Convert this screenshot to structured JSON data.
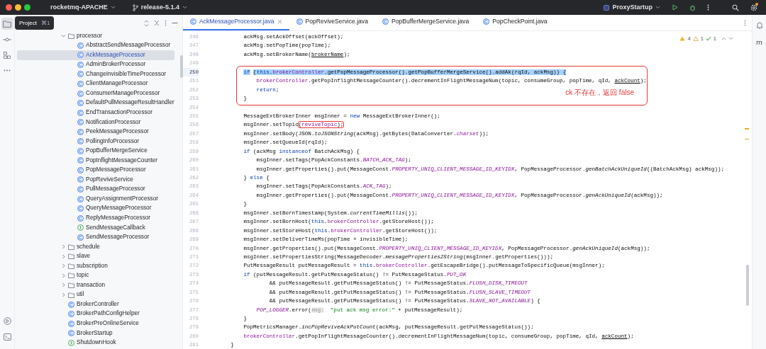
{
  "title_bar": {
    "project": "rocketmq-APACHE",
    "branch": "release-5.1.4",
    "run_config": "ProxyStartup"
  },
  "tooltip": {
    "label": "Project",
    "shortcut": "⌘1"
  },
  "tool_strip_top": [
    {
      "kind": "folder",
      "selected": true
    },
    {
      "kind": "commit",
      "selected": false
    },
    {
      "kind": "structure",
      "selected": false
    },
    {
      "kind": "more",
      "selected": false
    }
  ],
  "tool_strip_bottom": [
    {
      "kind": "run",
      "selected": false
    },
    {
      "kind": "terminal",
      "selected": false
    }
  ],
  "project_tree": [
    {
      "label": "processor",
      "kind": "folder",
      "expanded": true,
      "selected": false,
      "children": [
        {
          "label": "AbstractSendMessageProcessor",
          "kind": "class",
          "selected": false
        },
        {
          "label": "AckMessageProcessor",
          "kind": "class",
          "selected": true
        },
        {
          "label": "AdminBrokerProcessor",
          "kind": "class",
          "selected": false
        },
        {
          "label": "ChangeInvisibleTimeProcessor",
          "kind": "class",
          "selected": false
        },
        {
          "label": "ClientManageProcessor",
          "kind": "class",
          "selected": false
        },
        {
          "label": "ConsumerManageProcessor",
          "kind": "class",
          "selected": false
        },
        {
          "label": "DefaultPullMessageResultHandler",
          "kind": "class",
          "selected": false
        },
        {
          "label": "EndTransactionProcessor",
          "kind": "class",
          "selected": false
        },
        {
          "label": "NotificationProcessor",
          "kind": "class",
          "selected": false
        },
        {
          "label": "PeekMessageProcessor",
          "kind": "class",
          "selected": false
        },
        {
          "label": "PollingInfoProcessor",
          "kind": "class",
          "selected": false
        },
        {
          "label": "PopBufferMergeService",
          "kind": "class",
          "selected": false
        },
        {
          "label": "PopInflightMessageCounter",
          "kind": "class",
          "selected": false
        },
        {
          "label": "PopMessageProcessor",
          "kind": "class",
          "selected": false
        },
        {
          "label": "PopReviveService",
          "kind": "class",
          "selected": false
        },
        {
          "label": "PullMessageProcessor",
          "kind": "class",
          "selected": false
        },
        {
          "label": "QueryAssignmentProcessor",
          "kind": "class",
          "selected": false
        },
        {
          "label": "QueryMessageProcessor",
          "kind": "class",
          "selected": false
        },
        {
          "label": "ReplyMessageProcessor",
          "kind": "class",
          "selected": false
        },
        {
          "label": "SendMessageCallback",
          "kind": "interface",
          "selected": false
        },
        {
          "label": "SendMessageProcessor",
          "kind": "class",
          "selected": false
        }
      ]
    },
    {
      "label": "schedule",
      "kind": "folder",
      "expanded": false,
      "selected": false
    },
    {
      "label": "slave",
      "kind": "folder",
      "expanded": false,
      "selected": false
    },
    {
      "label": "subscription",
      "kind": "folder",
      "expanded": false,
      "selected": false
    },
    {
      "label": "topic",
      "kind": "folder",
      "expanded": false,
      "selected": false
    },
    {
      "label": "transaction",
      "kind": "folder",
      "expanded": false,
      "selected": false
    },
    {
      "label": "util",
      "kind": "folder",
      "expanded": false,
      "selected": false
    },
    {
      "label": "BrokerController",
      "kind": "class",
      "selected": false
    },
    {
      "label": "BrokerPathConfigHelper",
      "kind": "class",
      "selected": false
    },
    {
      "label": "BrokerPreOnlineService",
      "kind": "class",
      "selected": false
    },
    {
      "label": "BrokerStartup",
      "kind": "class",
      "selected": false
    },
    {
      "label": "ShutdownHook",
      "kind": "interface",
      "selected": false
    }
  ],
  "editor_tabs": [
    {
      "label": "AckMessageProcessor.java",
      "selected": true
    },
    {
      "label": "PopReviveService.java",
      "selected": false
    },
    {
      "label": "PopBufferMergeService.java",
      "selected": false
    },
    {
      "label": "PopCheckPoint.java",
      "selected": false
    }
  ],
  "inspections": {
    "warnings": "4",
    "weak_warnings": "1",
    "passed": "1"
  },
  "right_strip": {
    "plugin_glyph": "m"
  },
  "code_lines": [
    {
      "number": "246",
      "highlighted": false,
      "segments": [
        {
          "text": "        ackMsg.setAckOffset(ackOffset);",
          "kind": "plain"
        }
      ]
    },
    {
      "number": "247",
      "highlighted": false,
      "segments": [
        {
          "text": "        ackMsg.setPopTime(popTime);",
          "kind": "plain"
        }
      ]
    },
    {
      "number": "248",
      "highlighted": false,
      "segments": [
        {
          "text": "        ackMsg.setBrokerName(",
          "kind": "plain"
        },
        {
          "text": "brokerName",
          "kind": "underlined"
        },
        {
          "text": ");",
          "kind": "plain"
        }
      ]
    },
    {
      "number": "249",
      "highlighted": false
    },
    {
      "number": "250",
      "highlighted": true,
      "in_box": true,
      "segments": [
        {
          "text": "        if",
          "kind": "keyword"
        },
        {
          "text": " (",
          "kind": "plain"
        },
        {
          "text": "this",
          "kind": "keyword"
        },
        {
          "text": ".",
          "kind": "plain"
        },
        {
          "text": "brokerController",
          "kind": "field"
        },
        {
          "text": ".getPopMessageProcessor().getPopBufferMergeService().addAk(rqId, ackMsg)) {",
          "kind": "plain"
        }
      ]
    },
    {
      "number": "251",
      "highlighted": false,
      "in_box": true,
      "segments": [
        {
          "text": "            brokerController",
          "kind": "field"
        },
        {
          "text": ".getPopInflightMessageCounter().decrementInFlightMessageNum(topic, consumeGroup, popTime, qId, ",
          "kind": "plain"
        },
        {
          "text": "ackCount",
          "kind": "underlined"
        },
        {
          "text": ");",
          "kind": "plain"
        }
      ]
    },
    {
      "number": "252",
      "highlighted": false,
      "in_box": true,
      "note": "ck 不存在，返回 false",
      "segments": [
        {
          "text": "            return",
          "kind": "keyword"
        },
        {
          "text": ";",
          "kind": "plain"
        }
      ]
    },
    {
      "number": "253",
      "highlighted": false,
      "in_box": true,
      "segments": [
        {
          "text": "        }",
          "kind": "plain"
        }
      ]
    },
    {
      "number": "254",
      "highlighted": false
    },
    {
      "number": "255",
      "highlighted": false,
      "segments": [
        {
          "text": "        MessageExtBrokerInner msgInner = ",
          "kind": "plain"
        },
        {
          "text": "new",
          "kind": "keyword"
        },
        {
          "text": " MessageExtBrokerInner();",
          "kind": "plain"
        }
      ]
    },
    {
      "number": "256",
      "highlighted": false,
      "segments": [
        {
          "text": "        msgInner.setTopic",
          "kind": "plain"
        },
        {
          "text": "(",
          "kind": "plain",
          "circled": true
        },
        {
          "text": "reviveTopic",
          "kind": "field",
          "circled": true
        },
        {
          "text": ");",
          "kind": "plain",
          "circled": true
        }
      ]
    },
    {
      "number": "257",
      "highlighted": false,
      "segments": [
        {
          "text": "        msgInner.setBody(JSON.",
          "kind": "plain"
        },
        {
          "text": "toJSONString",
          "kind": "static"
        },
        {
          "text": "(ackMsg).getBytes(DataConverter.",
          "kind": "plain"
        },
        {
          "text": "charset",
          "kind": "constant"
        },
        {
          "text": "));",
          "kind": "plain"
        }
      ]
    },
    {
      "number": "258",
      "highlighted": false,
      "segments": [
        {
          "text": "        msgInner.setQueueId(rqId);",
          "kind": "plain"
        }
      ]
    },
    {
      "number": "259",
      "highlighted": false,
      "segments": [
        {
          "text": "        if",
          "kind": "keyword"
        },
        {
          "text": " (ackMsg ",
          "kind": "plain"
        },
        {
          "text": "instanceof",
          "kind": "keyword"
        },
        {
          "text": " BatchAckMsg) {",
          "kind": "plain"
        }
      ]
    },
    {
      "number": "260",
      "highlighted": false,
      "segments": [
        {
          "text": "            msgInner.setTags(PopAckConstants.",
          "kind": "plain"
        },
        {
          "text": "BATCH_ACK_TAG",
          "kind": "constant"
        },
        {
          "text": ");",
          "kind": "plain"
        }
      ]
    },
    {
      "number": "261",
      "highlighted": false,
      "segments": [
        {
          "text": "            msgInner.getProperties().put(MessageConst.",
          "kind": "plain"
        },
        {
          "text": "PROPERTY_UNIQ_CLIENT_MESSAGE_ID_KEYIDX",
          "kind": "constant"
        },
        {
          "text": ", PopMessageProcessor.",
          "kind": "plain"
        },
        {
          "text": "genBatchAckUniqueId",
          "kind": "static"
        },
        {
          "text": "((BatchAckMsg) ackMsg));",
          "kind": "plain"
        }
      ]
    },
    {
      "number": "262",
      "highlighted": false,
      "segments": [
        {
          "text": "        } ",
          "kind": "plain"
        },
        {
          "text": "else",
          "kind": "keyword"
        },
        {
          "text": " {",
          "kind": "plain"
        }
      ]
    },
    {
      "number": "263",
      "highlighted": false,
      "segments": [
        {
          "text": "            msgInner.setTags(PopAckConstants.",
          "kind": "plain"
        },
        {
          "text": "ACK_TAG",
          "kind": "constant"
        },
        {
          "text": ");",
          "kind": "plain"
        }
      ]
    },
    {
      "number": "264",
      "highlighted": false,
      "segments": [
        {
          "text": "            msgInner.getProperties().put(MessageConst.",
          "kind": "plain"
        },
        {
          "text": "PROPERTY_UNIQ_CLIENT_MESSAGE_ID_KEYIDX",
          "kind": "constant"
        },
        {
          "text": ", PopMessageProcessor.",
          "kind": "plain"
        },
        {
          "text": "genAckUniqueId",
          "kind": "static"
        },
        {
          "text": "(ackMsg));",
          "kind": "plain"
        }
      ]
    },
    {
      "number": "265",
      "highlighted": false,
      "segments": [
        {
          "text": "        }",
          "kind": "plain"
        }
      ]
    },
    {
      "number": "266",
      "highlighted": false,
      "segments": [
        {
          "text": "        msgInner.setBornTimestamp(System.",
          "kind": "plain"
        },
        {
          "text": "currentTimeMillis",
          "kind": "static"
        },
        {
          "text": "());",
          "kind": "plain"
        }
      ]
    },
    {
      "number": "267",
      "highlighted": false,
      "segments": [
        {
          "text": "        msgInner.setBornHost(",
          "kind": "plain"
        },
        {
          "text": "this",
          "kind": "keyword"
        },
        {
          "text": ".",
          "kind": "plain"
        },
        {
          "text": "brokerController",
          "kind": "field"
        },
        {
          "text": ".getStoreHost());",
          "kind": "plain"
        }
      ]
    },
    {
      "number": "268",
      "highlighted": false,
      "segments": [
        {
          "text": "        msgInner.setStoreHost(",
          "kind": "plain"
        },
        {
          "text": "this",
          "kind": "keyword"
        },
        {
          "text": ".",
          "kind": "plain"
        },
        {
          "text": "brokerController",
          "kind": "field"
        },
        {
          "text": ".getStoreHost());",
          "kind": "plain"
        }
      ]
    },
    {
      "number": "269",
      "highlighted": false,
      "segments": [
        {
          "text": "        msgInner.setDeliverTimeMs(popTime + invisibleTime);",
          "kind": "plain"
        }
      ]
    },
    {
      "number": "270",
      "highlighted": false,
      "segments": [
        {
          "text": "        msgInner.getProperties().put(MessageConst.",
          "kind": "plain"
        },
        {
          "text": "PROPERTY_UNIQ_CLIENT_MESSAGE_ID_KEYIDX",
          "kind": "constant"
        },
        {
          "text": ", PopMessageProcessor.",
          "kind": "plain"
        },
        {
          "text": "genAckUniqueId",
          "kind": "static"
        },
        {
          "text": "(ackMsg));",
          "kind": "plain"
        }
      ]
    },
    {
      "number": "271",
      "highlighted": false,
      "segments": [
        {
          "text": "        msgInner.setPropertiesString(MessageDecoder.",
          "kind": "plain"
        },
        {
          "text": "messageProperties2String",
          "kind": "static"
        },
        {
          "text": "(msgInner.getProperties()));",
          "kind": "plain"
        }
      ]
    },
    {
      "number": "272",
      "highlighted": false,
      "segments": [
        {
          "text": "        PutMessageResult putMessageResult = ",
          "kind": "plain"
        },
        {
          "text": "this",
          "kind": "keyword"
        },
        {
          "text": ".",
          "kind": "plain"
        },
        {
          "text": "brokerController",
          "kind": "field"
        },
        {
          "text": ".getEscapeBridge().putMessageToSpecificQueue(msgInner);",
          "kind": "plain"
        }
      ]
    },
    {
      "number": "273",
      "highlighted": false,
      "segments": [
        {
          "text": "        if",
          "kind": "keyword"
        },
        {
          "text": " (putMessageResult.getPutMessageStatus() != PutMessageStatus.",
          "kind": "plain"
        },
        {
          "text": "PUT_OK",
          "kind": "constant"
        }
      ]
    },
    {
      "number": "274",
      "highlighted": false,
      "segments": [
        {
          "text": "                && putMessageResult.getPutMessageStatus() != PutMessageStatus.",
          "kind": "plain"
        },
        {
          "text": "FLUSH_DISK_TIMEOUT",
          "kind": "constant"
        }
      ]
    },
    {
      "number": "275",
      "highlighted": false,
      "segments": [
        {
          "text": "                && putMessageResult.getPutMessageStatus() != PutMessageStatus.",
          "kind": "plain"
        },
        {
          "text": "FLUSH_SLAVE_TIMEOUT",
          "kind": "constant"
        }
      ]
    },
    {
      "number": "276",
      "highlighted": false,
      "segments": [
        {
          "text": "                && putMessageResult.getPutMessageStatus() != PutMessageStatus.",
          "kind": "plain"
        },
        {
          "text": "SLAVE_NOT_AVAILABLE",
          "kind": "constant"
        },
        {
          "text": ") {",
          "kind": "plain"
        }
      ]
    },
    {
      "number": "277",
      "highlighted": false,
      "segments": [
        {
          "text": "            POP_LOGGER",
          "kind": "constant"
        },
        {
          "text": ".error(",
          "kind": "plain"
        },
        {
          "text": "msg:",
          "kind": "hint"
        },
        {
          "text": " \"put ack msg error:\"",
          "kind": "string"
        },
        {
          "text": " + putMessageResult);",
          "kind": "plain"
        }
      ]
    },
    {
      "number": "278",
      "highlighted": false,
      "segments": [
        {
          "text": "        }",
          "kind": "plain"
        }
      ]
    },
    {
      "number": "279",
      "highlighted": false,
      "segments": [
        {
          "text": "        PopMetricsManager.",
          "kind": "plain"
        },
        {
          "text": "incPopReviveAckPutCount",
          "kind": "static"
        },
        {
          "text": "(ackMsg, putMessageResult.getPutMessageStatus());",
          "kind": "plain"
        }
      ]
    },
    {
      "number": "280",
      "highlighted": false,
      "segments": [
        {
          "text": "        brokerController",
          "kind": "field"
        },
        {
          "text": ".getPopInflightMessageCounter().decrementInFlightMessageNum(topic, consumeGroup, popTime, qId, ",
          "kind": "plain"
        },
        {
          "text": "ackCount",
          "kind": "underlined"
        },
        {
          "text": ");",
          "kind": "plain"
        }
      ]
    },
    {
      "number": "281",
      "highlighted": false,
      "segments": [
        {
          "text": "    }",
          "kind": "plain"
        }
      ]
    }
  ]
}
